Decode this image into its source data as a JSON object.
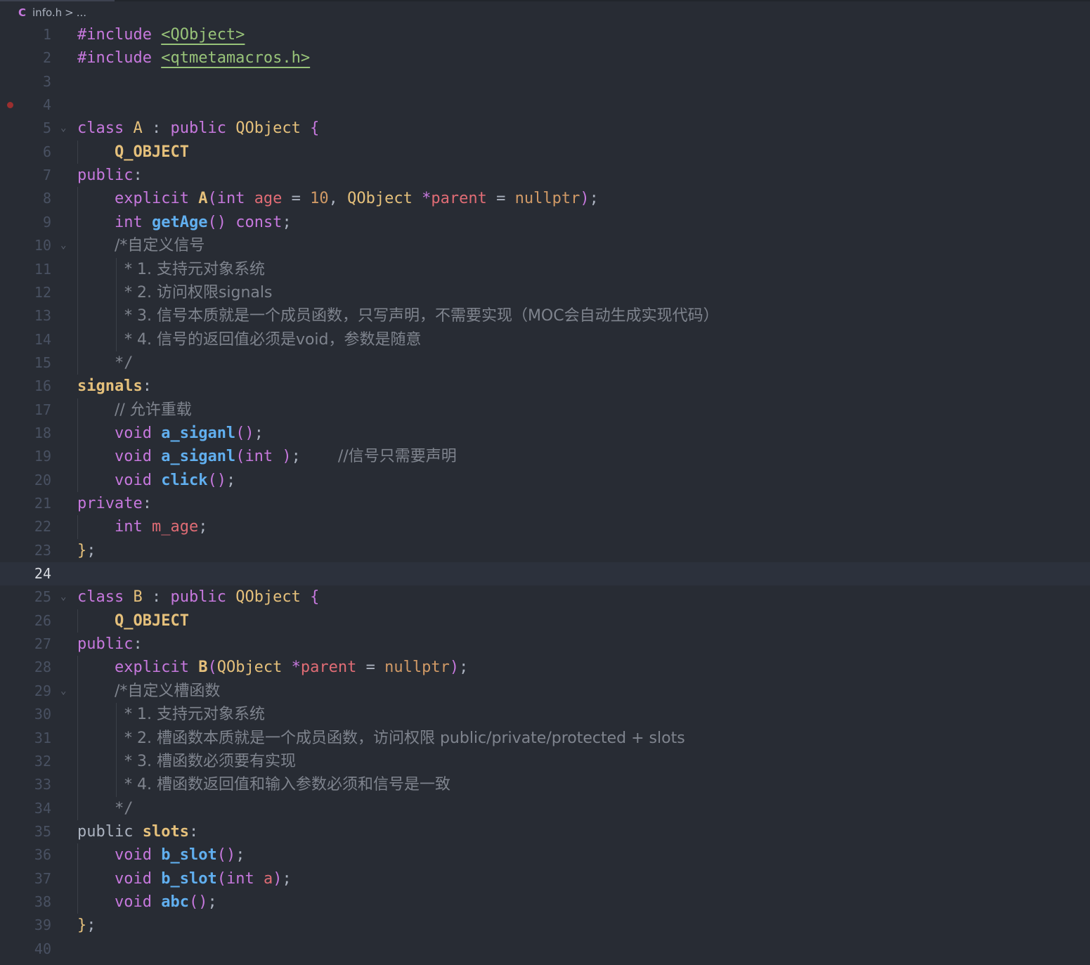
{
  "tab": {
    "language_icon": "C",
    "file_name": "info.h",
    "separator": ">",
    "ellipsis": "..."
  },
  "editor": {
    "current_line": 24,
    "breakpoint_line": 4,
    "lines": [
      {
        "n": "1",
        "t": [
          [
            "k",
            "#include "
          ],
          [
            "s",
            "<QObject>"
          ]
        ]
      },
      {
        "n": "2",
        "t": [
          [
            "k",
            "#include "
          ],
          [
            "s",
            "<qtmetamacros.h>"
          ]
        ]
      },
      {
        "n": "3",
        "t": []
      },
      {
        "n": "4",
        "t": []
      },
      {
        "n": "5",
        "fold": true,
        "t": [
          [
            "k",
            "class "
          ],
          [
            "t",
            "A "
          ],
          [
            "p",
            ": "
          ],
          [
            "k",
            "public "
          ],
          [
            "t",
            "QObject "
          ],
          [
            "pu",
            "{"
          ]
        ]
      },
      {
        "n": "6",
        "t": [
          [
            "p",
            "    "
          ],
          [
            "tb",
            "Q_OBJECT"
          ]
        ]
      },
      {
        "n": "7",
        "t": [
          [
            "k",
            "public"
          ],
          [
            "p",
            ":"
          ]
        ]
      },
      {
        "n": "8",
        "t": [
          [
            "p",
            "    "
          ],
          [
            "k",
            "explicit "
          ],
          [
            "tb",
            "A"
          ],
          [
            "pu",
            "("
          ],
          [
            "k",
            "int "
          ],
          [
            "v",
            "age "
          ],
          [
            "p",
            "= "
          ],
          [
            "n",
            "10"
          ],
          [
            "p",
            ", "
          ],
          [
            "t",
            "QObject "
          ],
          [
            "k",
            "*"
          ],
          [
            "v",
            "parent "
          ],
          [
            "p",
            "= "
          ],
          [
            "n",
            "nullptr"
          ],
          [
            "pu",
            ")"
          ],
          [
            "p",
            ";"
          ]
        ]
      },
      {
        "n": "9",
        "t": [
          [
            "p",
            "    "
          ],
          [
            "k",
            "int "
          ],
          [
            "fb",
            "getAge"
          ],
          [
            "pu",
            "() "
          ],
          [
            "k",
            "const"
          ],
          [
            "p",
            ";"
          ]
        ]
      },
      {
        "n": "10",
        "fold": true,
        "t": [
          [
            "p",
            "    "
          ],
          [
            "c",
            "/*自定义信号"
          ]
        ]
      },
      {
        "n": "11",
        "t": [
          [
            "p",
            "    "
          ],
          [
            "c",
            "  * 1. 支持元对象系统"
          ]
        ]
      },
      {
        "n": "12",
        "t": [
          [
            "p",
            "    "
          ],
          [
            "c",
            "  * 2. 访问权限signals"
          ]
        ]
      },
      {
        "n": "13",
        "t": [
          [
            "p",
            "    "
          ],
          [
            "c",
            "  * 3. 信号本质就是一个成员函数，只写声明，不需要实现（MOC会自动生成实现代码）"
          ]
        ]
      },
      {
        "n": "14",
        "t": [
          [
            "p",
            "    "
          ],
          [
            "c",
            "  * 4. 信号的返回值必须是void，参数是随意"
          ]
        ]
      },
      {
        "n": "15",
        "t": [
          [
            "p",
            "    "
          ],
          [
            "c",
            "*/"
          ]
        ]
      },
      {
        "n": "16",
        "t": [
          [
            "tb",
            "signals"
          ],
          [
            "p",
            ":"
          ]
        ]
      },
      {
        "n": "17",
        "t": [
          [
            "p",
            "    "
          ],
          [
            "c",
            "// 允许重载"
          ]
        ]
      },
      {
        "n": "18",
        "t": [
          [
            "p",
            "    "
          ],
          [
            "k",
            "void "
          ],
          [
            "fb",
            "a_siganl"
          ],
          [
            "pu",
            "()"
          ],
          [
            "p",
            ";"
          ]
        ]
      },
      {
        "n": "19",
        "t": [
          [
            "p",
            "    "
          ],
          [
            "k",
            "void "
          ],
          [
            "fb",
            "a_siganl"
          ],
          [
            "pu",
            "("
          ],
          [
            "k",
            "int "
          ],
          [
            "pu",
            ")"
          ],
          [
            "p",
            ";    "
          ],
          [
            "c",
            "//信号只需要声明"
          ]
        ]
      },
      {
        "n": "20",
        "t": [
          [
            "p",
            "    "
          ],
          [
            "k",
            "void "
          ],
          [
            "fb",
            "click"
          ],
          [
            "pu",
            "()"
          ],
          [
            "p",
            ";"
          ]
        ]
      },
      {
        "n": "21",
        "t": [
          [
            "k",
            "private"
          ],
          [
            "p",
            ":"
          ]
        ]
      },
      {
        "n": "22",
        "t": [
          [
            "p",
            "    "
          ],
          [
            "k",
            "int "
          ],
          [
            "v",
            "m_age"
          ],
          [
            "p",
            ";"
          ]
        ]
      },
      {
        "n": "23",
        "t": [
          [
            "t",
            "}"
          ],
          [
            "p",
            ";"
          ]
        ]
      },
      {
        "n": "24",
        "t": []
      },
      {
        "n": "25",
        "fold": true,
        "t": [
          [
            "k",
            "class "
          ],
          [
            "t",
            "B "
          ],
          [
            "p",
            ": "
          ],
          [
            "k",
            "public "
          ],
          [
            "t",
            "QObject "
          ],
          [
            "pu",
            "{"
          ]
        ]
      },
      {
        "n": "26",
        "t": [
          [
            "p",
            "    "
          ],
          [
            "tb",
            "Q_OBJECT"
          ]
        ]
      },
      {
        "n": "27",
        "t": [
          [
            "k",
            "public"
          ],
          [
            "p",
            ":"
          ]
        ]
      },
      {
        "n": "28",
        "t": [
          [
            "p",
            "    "
          ],
          [
            "k",
            "explicit "
          ],
          [
            "tb",
            "B"
          ],
          [
            "pu",
            "("
          ],
          [
            "t",
            "QObject "
          ],
          [
            "k",
            "*"
          ],
          [
            "v",
            "parent "
          ],
          [
            "p",
            "= "
          ],
          [
            "n",
            "nullptr"
          ],
          [
            "pu",
            ")"
          ],
          [
            "p",
            ";"
          ]
        ]
      },
      {
        "n": "29",
        "fold": true,
        "t": [
          [
            "p",
            "    "
          ],
          [
            "c",
            "/*自定义槽函数"
          ]
        ]
      },
      {
        "n": "30",
        "t": [
          [
            "p",
            "    "
          ],
          [
            "c",
            "  * 1. 支持元对象系统"
          ]
        ]
      },
      {
        "n": "31",
        "t": [
          [
            "p",
            "    "
          ],
          [
            "c",
            "  * 2. 槽函数本质就是一个成员函数，访问权限 public/private/protected + slots"
          ]
        ]
      },
      {
        "n": "32",
        "t": [
          [
            "p",
            "    "
          ],
          [
            "c",
            "  * 3. 槽函数必须要有实现"
          ]
        ]
      },
      {
        "n": "33",
        "t": [
          [
            "p",
            "    "
          ],
          [
            "c",
            "  * 4. 槽函数返回值和输入参数必须和信号是一致"
          ]
        ]
      },
      {
        "n": "34",
        "t": [
          [
            "p",
            "    "
          ],
          [
            "c",
            "*/"
          ]
        ]
      },
      {
        "n": "35",
        "t": [
          [
            "p",
            "public "
          ],
          [
            "tb",
            "slots"
          ],
          [
            "p",
            ":"
          ]
        ]
      },
      {
        "n": "36",
        "t": [
          [
            "p",
            "    "
          ],
          [
            "k",
            "void "
          ],
          [
            "fb",
            "b_slot"
          ],
          [
            "pu",
            "()"
          ],
          [
            "p",
            ";"
          ]
        ]
      },
      {
        "n": "37",
        "t": [
          [
            "p",
            "    "
          ],
          [
            "k",
            "void "
          ],
          [
            "fb",
            "b_slot"
          ],
          [
            "pu",
            "("
          ],
          [
            "k",
            "int "
          ],
          [
            "v",
            "a"
          ],
          [
            "pu",
            ")"
          ],
          [
            "p",
            ";"
          ]
        ]
      },
      {
        "n": "38",
        "t": [
          [
            "p",
            "    "
          ],
          [
            "k",
            "void "
          ],
          [
            "fb",
            "abc"
          ],
          [
            "pu",
            "()"
          ],
          [
            "p",
            ";"
          ]
        ]
      },
      {
        "n": "39",
        "t": [
          [
            "t",
            "}"
          ],
          [
            "p",
            ";"
          ]
        ]
      },
      {
        "n": "40",
        "t": []
      }
    ]
  }
}
